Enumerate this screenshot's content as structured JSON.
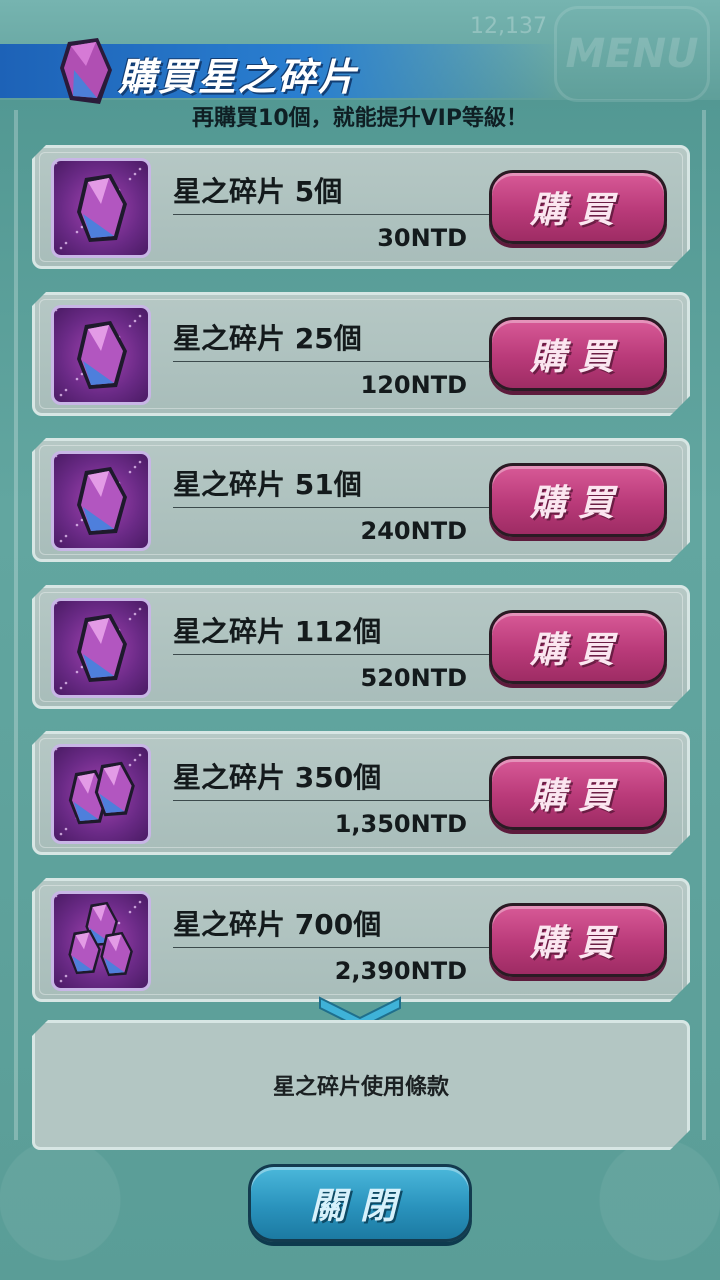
{
  "header": {
    "title": "購買星之碎片",
    "subtitle": "再購買10個，就能提升VIP等級！"
  },
  "background": {
    "menu_label": "MENU",
    "counter": "12,137"
  },
  "items": [
    {
      "name": "星之碎片 5個",
      "price": "30NTD",
      "buy_label": "購買",
      "gem_count": 1
    },
    {
      "name": "星之碎片 25個",
      "price": "120NTD",
      "buy_label": "購買",
      "gem_count": 1
    },
    {
      "name": "星之碎片 51個",
      "price": "240NTD",
      "buy_label": "購買",
      "gem_count": 1
    },
    {
      "name": "星之碎片 112個",
      "price": "520NTD",
      "buy_label": "購買",
      "gem_count": 1
    },
    {
      "name": "星之碎片 350個",
      "price": "1,350NTD",
      "buy_label": "購買",
      "gem_count": 2
    },
    {
      "name": "星之碎片 700個",
      "price": "2,390NTD",
      "buy_label": "購買",
      "gem_count": 3
    }
  ],
  "terms_label": "星之碎片使用條款",
  "close_label": "關閉",
  "colors": {
    "title_banner": "#2a7fd0",
    "buy_button": "#c44582",
    "close_button": "#2a93bd",
    "card_bg": "#b3c6c3"
  }
}
